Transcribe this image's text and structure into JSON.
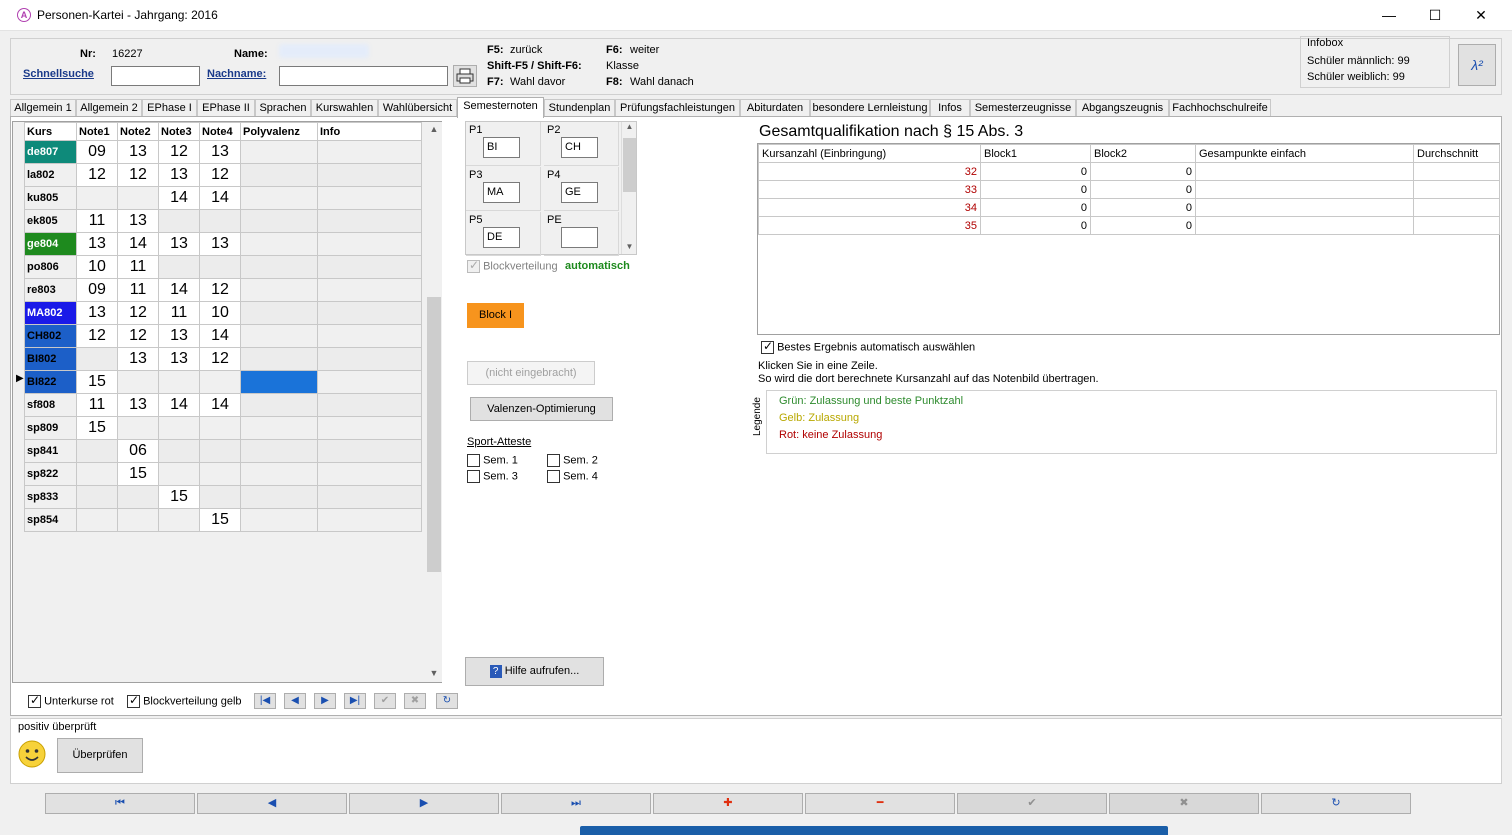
{
  "window": {
    "title": "Personen-Kartei - Jahrgang: 2016",
    "app_icon_letter": "A",
    "minimize": "—",
    "maximize": "☐",
    "close": "✕"
  },
  "header": {
    "nr_label": "Nr:",
    "nr_value": "16227",
    "name_label": "Name:",
    "name_value": "",
    "schnellsuche": "Schnellsuche",
    "schnellsuche_value": "",
    "nachname_label": "Nachname:",
    "nachname_value": "",
    "print_icon": "printer-icon",
    "shortcuts": [
      {
        "key": "F5:",
        "label": "zurück"
      },
      {
        "key": "Shift-F5 / Shift-F6:",
        "label": "Klasse"
      },
      {
        "key": "F7:",
        "label": "Wahl davor"
      },
      {
        "key": "F6:",
        "label": "weiter"
      },
      {
        "key": "F8:",
        "label": "Wahl danach"
      }
    ],
    "infobox_title": "Infobox",
    "infobox_line1": "Schüler männlich: 99",
    "infobox_line2": "Schüler weiblich: 99",
    "lambda_icon": "λ²"
  },
  "tabs": [
    "Allgemein 1",
    "Allgemein 2",
    "EPhase I",
    "EPhase II",
    "Sprachen",
    "Kurswahlen",
    "Wahlübersicht",
    "Semesternoten",
    "Stundenplan",
    "Prüfungsfachleistungen",
    "Abiturdaten",
    "besondere Lernleistung",
    "Infos",
    "Semesterzeugnisse",
    "Abgangszeugnis",
    "Fachhochschulreife"
  ],
  "active_tab": "Semesternoten",
  "grid": {
    "headers": [
      "Kurs",
      "Note1",
      "Note2",
      "Note3",
      "Note4",
      "Polyvalenz",
      "Info"
    ],
    "rows": [
      {
        "kurs": "de807",
        "n1": "09",
        "n2": "13",
        "n3": "12",
        "n4": "13",
        "color": "#0e8a7a",
        "text": "#ffffff"
      },
      {
        "kurs": "la802",
        "n1": "12",
        "n2": "12",
        "n3": "13",
        "n4": "12",
        "color": "",
        "text": "#000000"
      },
      {
        "kurs": "ku805",
        "n1": "",
        "n2": "",
        "n3": "14",
        "n4": "14",
        "color": "",
        "text": "#000000"
      },
      {
        "kurs": "ek805",
        "n1": "11",
        "n2": "13",
        "n3": "",
        "n4": "",
        "color": "",
        "text": "#000000"
      },
      {
        "kurs": "ge804",
        "n1": "13",
        "n2": "14",
        "n3": "13",
        "n4": "13",
        "color": "#1e8a1e",
        "text": "#ffffff"
      },
      {
        "kurs": "po806",
        "n1": "10",
        "n2": "11",
        "n3": "",
        "n4": "",
        "color": "",
        "text": "#000000"
      },
      {
        "kurs": "re803",
        "n1": "09",
        "n2": "11",
        "n3": "14",
        "n4": "12",
        "color": "",
        "text": "#000000"
      },
      {
        "kurs": "MA802",
        "n1": "13",
        "n2": "12",
        "n3": "11",
        "n4": "10",
        "color": "#1a1ae8",
        "text": "#ffffff"
      },
      {
        "kurs": "CH802",
        "n1": "12",
        "n2": "12",
        "n3": "13",
        "n4": "14",
        "color": "#1c5fc8",
        "text": "#000000"
      },
      {
        "kurs": "BI802",
        "n1": "",
        "n2": "13",
        "n3": "13",
        "n4": "12",
        "color": "#1c5fc8",
        "text": "#000000"
      },
      {
        "kurs": "BI822",
        "n1": "15",
        "n2": "",
        "n3": "",
        "n4": "",
        "color": "#1c5fc8",
        "text": "#000000"
      },
      {
        "kurs": "sf808",
        "n1": "11",
        "n2": "13",
        "n3": "14",
        "n4": "14",
        "color": "",
        "text": "#000000"
      },
      {
        "kurs": "sp809",
        "n1": "15",
        "n2": "",
        "n3": "",
        "n4": "",
        "color": "",
        "text": "#000000"
      },
      {
        "kurs": "sp841",
        "n1": "",
        "n2": "06",
        "n3": "",
        "n4": "",
        "color": "",
        "text": "#000000"
      },
      {
        "kurs": "sp822",
        "n1": "",
        "n2": "15",
        "n3": "",
        "n4": "",
        "color": "",
        "text": "#000000"
      },
      {
        "kurs": "sp833",
        "n1": "",
        "n2": "",
        "n3": "15",
        "n4": "",
        "color": "",
        "text": "#000000"
      },
      {
        "kurs": "sp854",
        "n1": "",
        "n2": "",
        "n3": "",
        "n4": "15",
        "color": "",
        "text": "#000000"
      }
    ],
    "selected_row_index": 10,
    "selection_color": "#1a73d9",
    "row_indicator": "▶"
  },
  "below_grid": {
    "unterkurse_rot": "Unterkurse rot",
    "blockverteilung_gelb": "Blockverteilung gelb",
    "nav_icons": [
      "first-icon",
      "prev-icon",
      "next-icon",
      "last-icon",
      "post-icon",
      "cancel-icon",
      "refresh-icon"
    ]
  },
  "pruefung": {
    "cells": [
      {
        "label": "P1",
        "value": "BI"
      },
      {
        "label": "P2",
        "value": "CH"
      },
      {
        "label": "P3",
        "value": "MA"
      },
      {
        "label": "P4",
        "value": "GE"
      },
      {
        "label": "P5",
        "value": "DE"
      },
      {
        "label": "PE",
        "value": ""
      }
    ],
    "blockverteilung": "Blockverteilung",
    "automatisch": "automatisch",
    "block_button": "Block I",
    "block_color": "#f7941d",
    "nicht_eingebracht": "(nicht eingebracht)",
    "valenzen": "Valenzen-Optimierung",
    "sport_title": "Sport-Atteste",
    "sem1": "Sem. 1",
    "sem2": "Sem. 2",
    "sem3": "Sem. 3",
    "sem4": "Sem. 4",
    "hilfe": "Hilfe aufrufen..."
  },
  "qualifikation": {
    "title": "Gesamtqualifikation nach § 15 Abs. 3",
    "headers": [
      "Kursanzahl (Einbringung)",
      "Block1",
      "Block2",
      "Gesampunkte einfach",
      "Durchschnitt"
    ],
    "rows": [
      {
        "k": "32",
        "b1": "0",
        "b2": "0",
        "g": "",
        "d": ""
      },
      {
        "k": "33",
        "b1": "0",
        "b2": "0",
        "g": "",
        "d": ""
      },
      {
        "k": "34",
        "b1": "0",
        "b2": "0",
        "g": "",
        "d": ""
      },
      {
        "k": "35",
        "b1": "0",
        "b2": "0",
        "g": "",
        "d": ""
      }
    ],
    "bestes": "Bestes Ergebnis automatisch auswählen",
    "hint1": "Klicken Sie in eine Zeile.",
    "hint2": "So wird die dort berechnete Kursanzahl auf das Notenbild übertragen.",
    "legende_title": "Legende",
    "legend_green": "Grün: Zulassung und beste Punktzahl",
    "legend_yellow": "Gelb: Zulassung",
    "legend_red": "Rot: keine Zulassung",
    "color_green": "#2e8b2e",
    "color_yellow": "#b8a800",
    "color_red": "#b00000"
  },
  "status": {
    "text": "positiv überprüft",
    "smiley_icon": "smiley-icon",
    "ueberpruefen": "Überprüfen"
  },
  "footer": {
    "buttons": [
      "⏮",
      "◀",
      "▶",
      "⏭",
      "✚",
      "━",
      "✔",
      "✖",
      "↻"
    ],
    "names": [
      "first-record-icon",
      "prev-record-icon",
      "next-record-icon",
      "last-record-icon",
      "add-icon",
      "delete-icon",
      "post-icon",
      "cancel-icon",
      "refresh-icon"
    ]
  }
}
